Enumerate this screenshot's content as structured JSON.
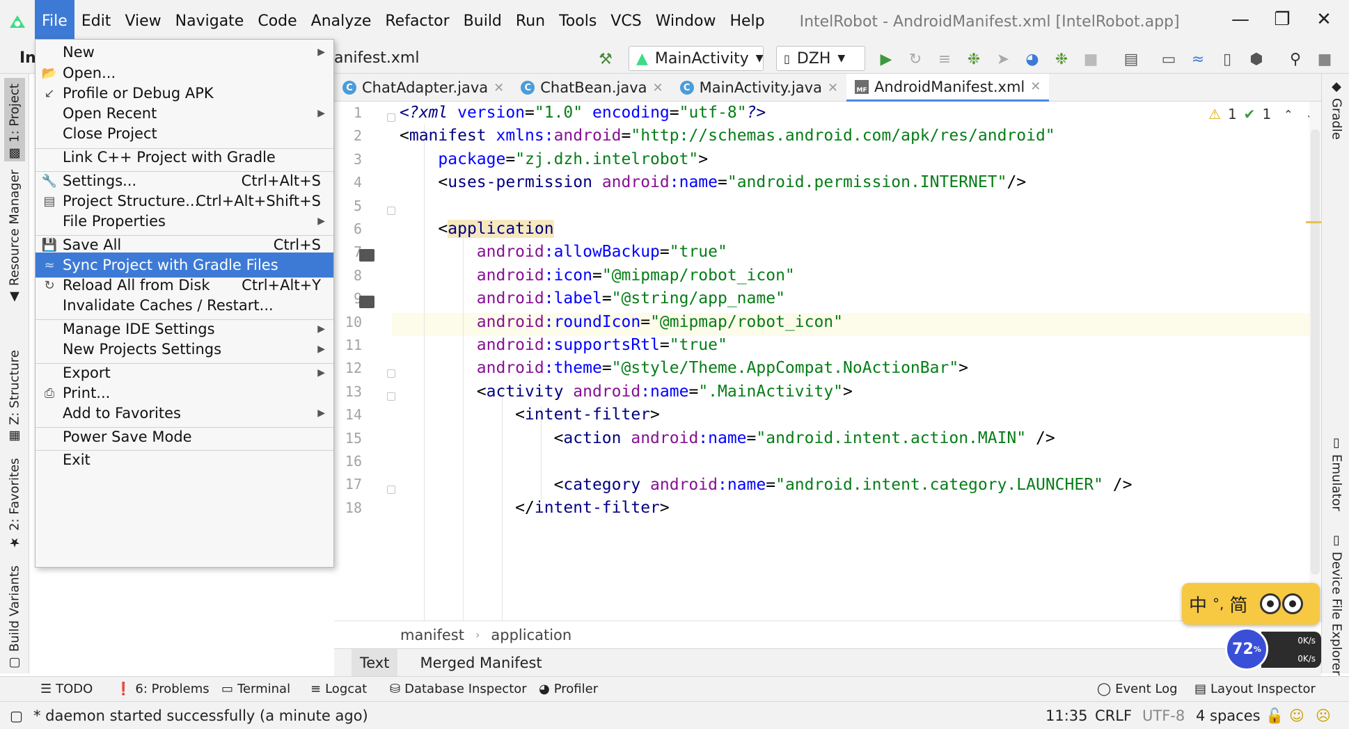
{
  "menubar": {
    "items": [
      "File",
      "Edit",
      "View",
      "Navigate",
      "Code",
      "Analyze",
      "Refactor",
      "Build",
      "Run",
      "Tools",
      "VCS",
      "Window",
      "Help"
    ],
    "window_title": "IntelRobot - AndroidManifest.xml [IntelRobot.app]"
  },
  "toolbar": {
    "breadcrumb_trunc": "In",
    "file_crumb": "anifest.xml",
    "run_config": "MainActivity",
    "device": "DZH"
  },
  "editor_tabs": [
    {
      "label": "ChatAdapter.java"
    },
    {
      "label": "ChatBean.java"
    },
    {
      "label": "MainActivity.java"
    },
    {
      "label": "AndroidManifest.xml"
    }
  ],
  "editor": {
    "line_numbers": [
      "1",
      "2",
      "3",
      "4",
      "5",
      "6",
      "7",
      "8",
      "9",
      "10",
      "11",
      "12",
      "13",
      "14",
      "15",
      "16",
      "17",
      "18"
    ],
    "inspection": {
      "warnings": "1",
      "ok": "1"
    }
  },
  "file_menu": {
    "items": [
      {
        "label": "New"
      },
      {
        "label": "Open..."
      },
      {
        "label": "Profile or Debug APK"
      },
      {
        "label": "Open Recent"
      },
      {
        "label": "Close Project"
      },
      {
        "label": "Link C++ Project with Gradle"
      },
      {
        "label": "Settings...",
        "shortcut": "Ctrl+Alt+S"
      },
      {
        "label": "Project Structure...",
        "shortcut": "Ctrl+Alt+Shift+S"
      },
      {
        "label": "File Properties"
      },
      {
        "label": "Save All",
        "shortcut": "Ctrl+S"
      },
      {
        "label": "Sync Project with Gradle Files"
      },
      {
        "label": "Reload All from Disk",
        "shortcut": "Ctrl+Alt+Y"
      },
      {
        "label": "Invalidate Caches / Restart..."
      },
      {
        "label": "Manage IDE Settings"
      },
      {
        "label": "New Projects Settings"
      },
      {
        "label": "Export"
      },
      {
        "label": "Print..."
      },
      {
        "label": "Add to Favorites"
      },
      {
        "label": "Power Save Mode"
      },
      {
        "label": "Exit"
      }
    ]
  },
  "left_strip": [
    "1: Project",
    "Resource Manager",
    "Z: Structure",
    "2: Favorites",
    "Build Variants"
  ],
  "right_strip": [
    "Gradle",
    "Emulator",
    "Device File Explorer"
  ],
  "editor_breadcrumbs": [
    "manifest",
    "application"
  ],
  "manifest_tabs": [
    "Text",
    "Merged Manifest"
  ],
  "tool_windows": {
    "todo": "TODO",
    "problems": "6: Problems",
    "terminal": "Terminal",
    "logcat": "Logcat",
    "database": "Database Inspector",
    "profiler": "Profiler",
    "event_log": "Event Log",
    "layout_inspector": "Layout Inspector"
  },
  "status": {
    "message": "* daemon started successfully (a minute ago)",
    "position": "11:35",
    "line_sep": "CRLF",
    "encoding": "UTF-8",
    "indent": "4 spaces"
  },
  "ime": {
    "lang": "中",
    "mode": "简",
    "punct": "°,"
  },
  "speed_widget": {
    "value": "72",
    "unit": "%",
    "up": "0K/s",
    "down": "0K/s"
  },
  "colors": {
    "accent": "#3d7ad6",
    "tag": "#000080",
    "attr": "#0000ff",
    "namespace": "#871094",
    "value": "#067d17"
  }
}
